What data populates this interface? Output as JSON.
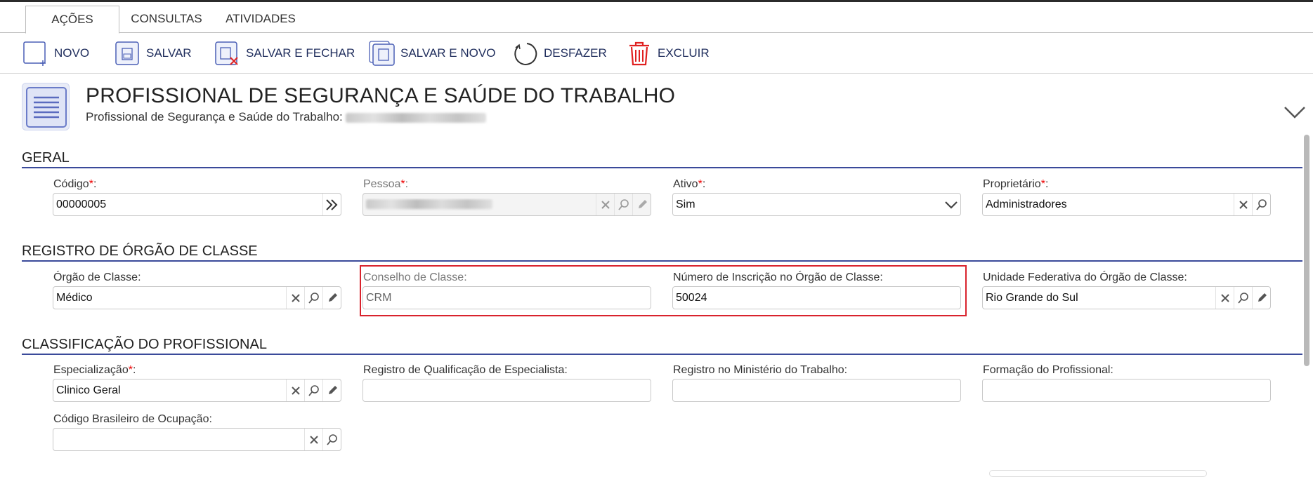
{
  "tabs": [
    {
      "label": "AÇÕES",
      "active": true
    },
    {
      "label": "CONSULTAS",
      "active": false
    },
    {
      "label": "ATIVIDADES",
      "active": false
    }
  ],
  "toolbar": {
    "novo": "NOVO",
    "salvar": "SALVAR",
    "salvar_fechar": "SALVAR E FECHAR",
    "salvar_novo": "SALVAR E NOVO",
    "desfazer": "DESFAZER",
    "excluir": "EXCLUIR"
  },
  "header": {
    "title": "PROFISSIONAL DE SEGURANÇA E SAÚDE DO TRABALHO",
    "subtitle": "Profissional de Segurança e Saúde do Trabalho:"
  },
  "sections": {
    "geral": "GERAL",
    "registro": "REGISTRO DE ÓRGÃO DE CLASSE",
    "classificacao": "CLASSIFICAÇÃO DO PROFISSIONAL"
  },
  "fields": {
    "codigo": {
      "label": "Código",
      "value": "00000005"
    },
    "pessoa": {
      "label": "Pessoa",
      "value": ""
    },
    "ativo": {
      "label": "Ativo",
      "value": "Sim"
    },
    "proprietario": {
      "label": "Proprietário",
      "value": "Administradores"
    },
    "orgao_classe": {
      "label": "Órgão de Classe:",
      "value": "Médico"
    },
    "conselho_classe": {
      "label": "Conselho de Classe:",
      "value": "CRM"
    },
    "numero_inscricao": {
      "label": "Número de Inscrição no Órgão de Classe:",
      "value": "50024"
    },
    "unidade_federativa": {
      "label": "Unidade Federativa do Órgão de Classe:",
      "value": "Rio Grande do Sul"
    },
    "especializacao": {
      "label": "Especialização",
      "value": "Clinico Geral"
    },
    "registro_qualificacao": {
      "label": "Registro de Qualificação de Especialista:",
      "value": ""
    },
    "registro_ministerio": {
      "label": "Registro no Ministério do Trabalho:",
      "value": ""
    },
    "formacao": {
      "label": "Formação do Profissional:",
      "value": ""
    },
    "cbo": {
      "label": "Código Brasileiro de Ocupação:",
      "value": ""
    }
  },
  "required_marker": "*",
  "label_suffix": ":",
  "colors": {
    "accent": "#3a4a9a",
    "required": "#e00000",
    "highlight": "#d9232d",
    "toolbar_text": "#1f2d5c"
  },
  "icons": [
    "new-doc-icon",
    "save-icon",
    "save-close-icon",
    "save-new-icon",
    "undo-icon",
    "trash-icon",
    "list-doc-icon",
    "chevron-down-icon",
    "clear-icon",
    "search-icon",
    "edit-icon",
    "next-icon"
  ]
}
